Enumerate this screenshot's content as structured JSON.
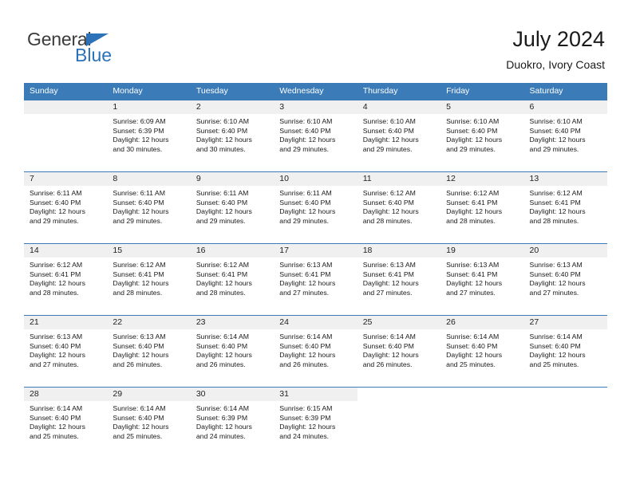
{
  "brand": {
    "name_part1": "General",
    "name_part2": "Blue",
    "triangle_icon": "triangle-icon",
    "colors": {
      "blue": "#2b72b8",
      "dark": "#3b3b3b"
    }
  },
  "header": {
    "title": "July 2024",
    "subtitle": "Duokro, Ivory Coast",
    "header_bg": "#3b7cb8"
  },
  "weekdays": [
    "Sunday",
    "Monday",
    "Tuesday",
    "Wednesday",
    "Thursday",
    "Friday",
    "Saturday"
  ],
  "labels": {
    "sunrise_prefix": "Sunrise:",
    "sunset_prefix": "Sunset:",
    "daylight_prefix": "Daylight:"
  },
  "weeks": [
    [
      {
        "day": "",
        "sunrise": "",
        "sunset": "",
        "daylight1": "",
        "daylight2": ""
      },
      {
        "day": "1",
        "sunrise": "Sunrise: 6:09 AM",
        "sunset": "Sunset: 6:39 PM",
        "daylight1": "Daylight: 12 hours",
        "daylight2": "and 30 minutes."
      },
      {
        "day": "2",
        "sunrise": "Sunrise: 6:10 AM",
        "sunset": "Sunset: 6:40 PM",
        "daylight1": "Daylight: 12 hours",
        "daylight2": "and 30 minutes."
      },
      {
        "day": "3",
        "sunrise": "Sunrise: 6:10 AM",
        "sunset": "Sunset: 6:40 PM",
        "daylight1": "Daylight: 12 hours",
        "daylight2": "and 29 minutes."
      },
      {
        "day": "4",
        "sunrise": "Sunrise: 6:10 AM",
        "sunset": "Sunset: 6:40 PM",
        "daylight1": "Daylight: 12 hours",
        "daylight2": "and 29 minutes."
      },
      {
        "day": "5",
        "sunrise": "Sunrise: 6:10 AM",
        "sunset": "Sunset: 6:40 PM",
        "daylight1": "Daylight: 12 hours",
        "daylight2": "and 29 minutes."
      },
      {
        "day": "6",
        "sunrise": "Sunrise: 6:10 AM",
        "sunset": "Sunset: 6:40 PM",
        "daylight1": "Daylight: 12 hours",
        "daylight2": "and 29 minutes."
      }
    ],
    [
      {
        "day": "7",
        "sunrise": "Sunrise: 6:11 AM",
        "sunset": "Sunset: 6:40 PM",
        "daylight1": "Daylight: 12 hours",
        "daylight2": "and 29 minutes."
      },
      {
        "day": "8",
        "sunrise": "Sunrise: 6:11 AM",
        "sunset": "Sunset: 6:40 PM",
        "daylight1": "Daylight: 12 hours",
        "daylight2": "and 29 minutes."
      },
      {
        "day": "9",
        "sunrise": "Sunrise: 6:11 AM",
        "sunset": "Sunset: 6:40 PM",
        "daylight1": "Daylight: 12 hours",
        "daylight2": "and 29 minutes."
      },
      {
        "day": "10",
        "sunrise": "Sunrise: 6:11 AM",
        "sunset": "Sunset: 6:40 PM",
        "daylight1": "Daylight: 12 hours",
        "daylight2": "and 29 minutes."
      },
      {
        "day": "11",
        "sunrise": "Sunrise: 6:12 AM",
        "sunset": "Sunset: 6:40 PM",
        "daylight1": "Daylight: 12 hours",
        "daylight2": "and 28 minutes."
      },
      {
        "day": "12",
        "sunrise": "Sunrise: 6:12 AM",
        "sunset": "Sunset: 6:41 PM",
        "daylight1": "Daylight: 12 hours",
        "daylight2": "and 28 minutes."
      },
      {
        "day": "13",
        "sunrise": "Sunrise: 6:12 AM",
        "sunset": "Sunset: 6:41 PM",
        "daylight1": "Daylight: 12 hours",
        "daylight2": "and 28 minutes."
      }
    ],
    [
      {
        "day": "14",
        "sunrise": "Sunrise: 6:12 AM",
        "sunset": "Sunset: 6:41 PM",
        "daylight1": "Daylight: 12 hours",
        "daylight2": "and 28 minutes."
      },
      {
        "day": "15",
        "sunrise": "Sunrise: 6:12 AM",
        "sunset": "Sunset: 6:41 PM",
        "daylight1": "Daylight: 12 hours",
        "daylight2": "and 28 minutes."
      },
      {
        "day": "16",
        "sunrise": "Sunrise: 6:12 AM",
        "sunset": "Sunset: 6:41 PM",
        "daylight1": "Daylight: 12 hours",
        "daylight2": "and 28 minutes."
      },
      {
        "day": "17",
        "sunrise": "Sunrise: 6:13 AM",
        "sunset": "Sunset: 6:41 PM",
        "daylight1": "Daylight: 12 hours",
        "daylight2": "and 27 minutes."
      },
      {
        "day": "18",
        "sunrise": "Sunrise: 6:13 AM",
        "sunset": "Sunset: 6:41 PM",
        "daylight1": "Daylight: 12 hours",
        "daylight2": "and 27 minutes."
      },
      {
        "day": "19",
        "sunrise": "Sunrise: 6:13 AM",
        "sunset": "Sunset: 6:41 PM",
        "daylight1": "Daylight: 12 hours",
        "daylight2": "and 27 minutes."
      },
      {
        "day": "20",
        "sunrise": "Sunrise: 6:13 AM",
        "sunset": "Sunset: 6:40 PM",
        "daylight1": "Daylight: 12 hours",
        "daylight2": "and 27 minutes."
      }
    ],
    [
      {
        "day": "21",
        "sunrise": "Sunrise: 6:13 AM",
        "sunset": "Sunset: 6:40 PM",
        "daylight1": "Daylight: 12 hours",
        "daylight2": "and 27 minutes."
      },
      {
        "day": "22",
        "sunrise": "Sunrise: 6:13 AM",
        "sunset": "Sunset: 6:40 PM",
        "daylight1": "Daylight: 12 hours",
        "daylight2": "and 26 minutes."
      },
      {
        "day": "23",
        "sunrise": "Sunrise: 6:14 AM",
        "sunset": "Sunset: 6:40 PM",
        "daylight1": "Daylight: 12 hours",
        "daylight2": "and 26 minutes."
      },
      {
        "day": "24",
        "sunrise": "Sunrise: 6:14 AM",
        "sunset": "Sunset: 6:40 PM",
        "daylight1": "Daylight: 12 hours",
        "daylight2": "and 26 minutes."
      },
      {
        "day": "25",
        "sunrise": "Sunrise: 6:14 AM",
        "sunset": "Sunset: 6:40 PM",
        "daylight1": "Daylight: 12 hours",
        "daylight2": "and 26 minutes."
      },
      {
        "day": "26",
        "sunrise": "Sunrise: 6:14 AM",
        "sunset": "Sunset: 6:40 PM",
        "daylight1": "Daylight: 12 hours",
        "daylight2": "and 25 minutes."
      },
      {
        "day": "27",
        "sunrise": "Sunrise: 6:14 AM",
        "sunset": "Sunset: 6:40 PM",
        "daylight1": "Daylight: 12 hours",
        "daylight2": "and 25 minutes."
      }
    ],
    [
      {
        "day": "28",
        "sunrise": "Sunrise: 6:14 AM",
        "sunset": "Sunset: 6:40 PM",
        "daylight1": "Daylight: 12 hours",
        "daylight2": "and 25 minutes."
      },
      {
        "day": "29",
        "sunrise": "Sunrise: 6:14 AM",
        "sunset": "Sunset: 6:40 PM",
        "daylight1": "Daylight: 12 hours",
        "daylight2": "and 25 minutes."
      },
      {
        "day": "30",
        "sunrise": "Sunrise: 6:14 AM",
        "sunset": "Sunset: 6:39 PM",
        "daylight1": "Daylight: 12 hours",
        "daylight2": "and 24 minutes."
      },
      {
        "day": "31",
        "sunrise": "Sunrise: 6:15 AM",
        "sunset": "Sunset: 6:39 PM",
        "daylight1": "Daylight: 12 hours",
        "daylight2": "and 24 minutes."
      },
      {
        "day": "",
        "sunrise": "",
        "sunset": "",
        "daylight1": "",
        "daylight2": ""
      },
      {
        "day": "",
        "sunrise": "",
        "sunset": "",
        "daylight1": "",
        "daylight2": ""
      },
      {
        "day": "",
        "sunrise": "",
        "sunset": "",
        "daylight1": "",
        "daylight2": ""
      }
    ]
  ]
}
